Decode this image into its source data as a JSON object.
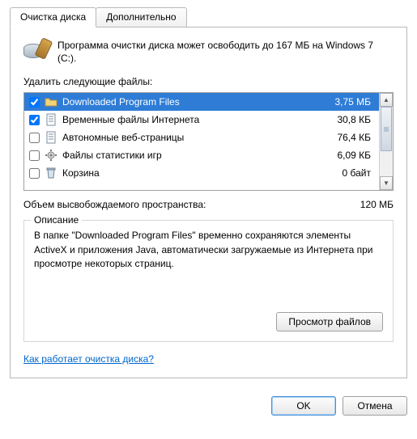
{
  "tabs": {
    "cleanup": "Очистка диска",
    "advanced": "Дополнительно"
  },
  "intro": "Программа очистки диска может освободить до 167 МБ на Windows 7 (C:).",
  "deleteLabel": "Удалить следующие файлы:",
  "items": [
    {
      "name": "Downloaded Program Files",
      "size": "3,75 МБ",
      "checked": true,
      "selected": true,
      "icon": "folder"
    },
    {
      "name": "Временные файлы Интернета",
      "size": "30,8 КБ",
      "checked": true,
      "selected": false,
      "icon": "page"
    },
    {
      "name": "Автономные веб-страницы",
      "size": "76,4 КБ",
      "checked": false,
      "selected": false,
      "icon": "page"
    },
    {
      "name": "Файлы статистики игр",
      "size": "6,09 КБ",
      "checked": false,
      "selected": false,
      "icon": "gear"
    },
    {
      "name": "Корзина",
      "size": "0 байт",
      "checked": false,
      "selected": false,
      "icon": "bin"
    }
  ],
  "total": {
    "label": "Объем высвобождаемого пространства:",
    "value": "120 МБ"
  },
  "description": {
    "title": "Описание",
    "text": "В папке \"Downloaded Program Files\" временно сохраняются элементы ActiveX и приложения Java, автоматически загружаемые из Интернета при просмотре некоторых страниц."
  },
  "viewFiles": "Просмотр файлов",
  "helpLink": "Как работает очистка диска?",
  "ok": "OK",
  "cancel": "Отмена"
}
